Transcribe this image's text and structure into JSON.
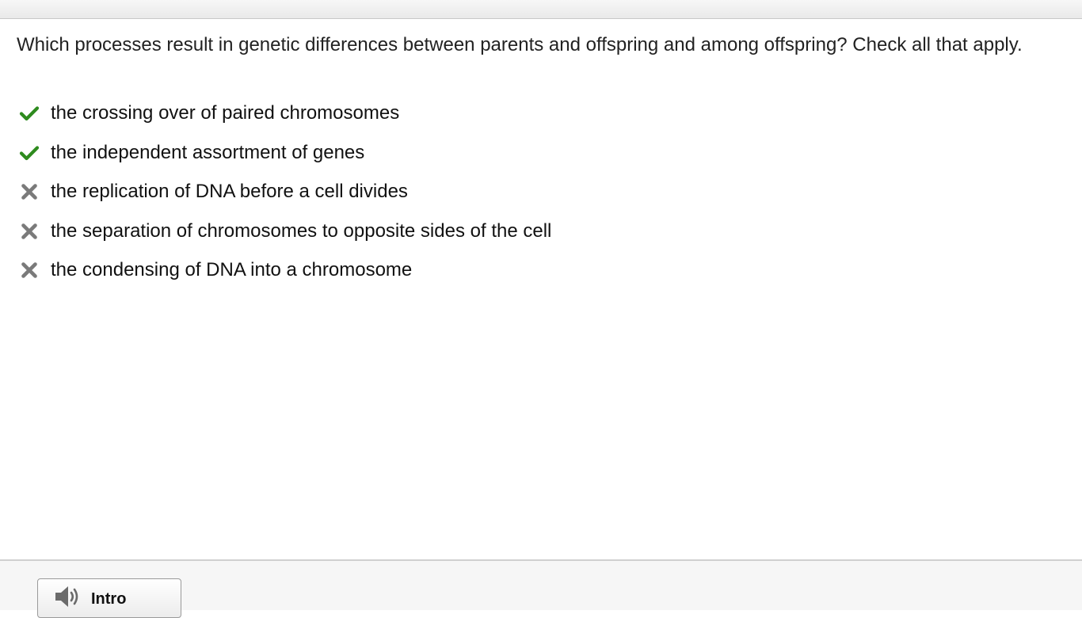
{
  "question": {
    "text": "Which processes result in genetic differences between parents and offspring and among offspring? Check all that apply."
  },
  "answers": [
    {
      "text": "the crossing over of paired chromosomes",
      "status": "correct",
      "icon": "check-icon"
    },
    {
      "text": "the independent assortment of genes",
      "status": "correct",
      "icon": "check-icon"
    },
    {
      "text": "the replication of DNA before a cell divides",
      "status": "incorrect",
      "icon": "x-icon"
    },
    {
      "text": "the separation of chromosomes to opposite sides of the cell",
      "status": "incorrect",
      "icon": "x-icon"
    },
    {
      "text": "the condensing of DNA into a chromosome",
      "status": "incorrect",
      "icon": "x-icon"
    }
  ],
  "colors": {
    "check": "#2e8b1e",
    "x_mark": "#7a7a7a"
  },
  "footer": {
    "intro_button": {
      "label": "Intro",
      "icon": "speaker-icon"
    }
  }
}
